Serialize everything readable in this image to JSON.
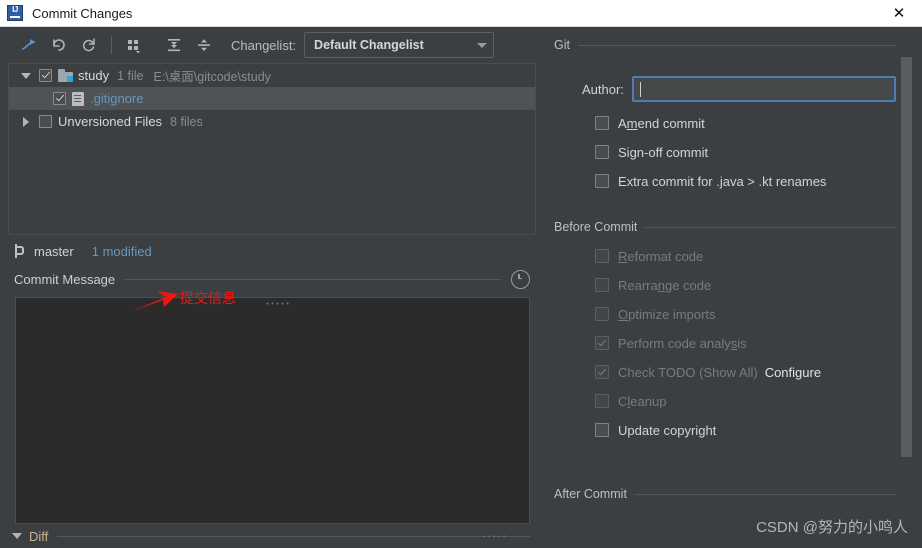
{
  "window": {
    "title": "Commit Changes",
    "app_icon": "intellij-idea-icon",
    "close_label": "✕"
  },
  "toolbar": {
    "icons": [
      {
        "name": "show-diff-icon",
        "glyph": "diff"
      },
      {
        "name": "revert-icon",
        "glyph": "revert"
      },
      {
        "name": "refresh-icon",
        "glyph": "refresh"
      },
      {
        "name": "group-by-icon",
        "glyph": "group"
      },
      {
        "name": "expand-all-icon",
        "glyph": "expand"
      },
      {
        "name": "collapse-all-icon",
        "glyph": "collapse"
      }
    ],
    "changelist_label": "Changelist:",
    "changelist_value": "Default Changelist"
  },
  "tree": {
    "rows": [
      {
        "twisty": "down",
        "checked": true,
        "icon": "folder-icon",
        "name": "study",
        "meta": "1 file",
        "path": "E:\\桌面\\gitcode\\study",
        "selected": false,
        "link": false
      },
      {
        "twisty": "none",
        "checked": true,
        "icon": "file-icon",
        "name": ".gitignore",
        "meta": "",
        "path": "",
        "selected": true,
        "link": true
      },
      {
        "twisty": "right",
        "checked": false,
        "icon": "none",
        "name": "Unversioned Files",
        "meta": "8 files",
        "path": "",
        "selected": false,
        "link": false
      }
    ]
  },
  "branch_bar": {
    "icon": "branch-icon",
    "branch": "master",
    "modified": "1 modified"
  },
  "commit_message": {
    "title": "Commit Message",
    "value": "",
    "placeholder": "",
    "history_icon": "clock-icon"
  },
  "diff": {
    "label": "Diff",
    "expanded": true
  },
  "git_section": {
    "title": "Git",
    "author_label": "Author:",
    "author_value": "",
    "author_placeholder": "",
    "options": [
      {
        "label_pre": "A",
        "label_mn": "m",
        "label_post": "end commit",
        "checked": false,
        "disabled": false,
        "name": "amend-commit-checkbox"
      },
      {
        "label_pre": "Si",
        "label_mn": "g",
        "label_post": "n-off commit",
        "checked": false,
        "disabled": false,
        "name": "sign-off-commit-checkbox"
      },
      {
        "label_pre": "Extra commit for .java > .kt renames",
        "label_mn": "",
        "label_post": "",
        "checked": false,
        "disabled": false,
        "name": "extra-commit-renames-checkbox"
      }
    ]
  },
  "before_commit_section": {
    "title": "Before Commit",
    "options": [
      {
        "label_pre": "",
        "label_mn": "R",
        "label_post": "eformat code",
        "checked": false,
        "disabled": true,
        "name": "reformat-code-checkbox"
      },
      {
        "label_pre": "Rearra",
        "label_mn": "n",
        "label_post": "ge code",
        "checked": false,
        "disabled": true,
        "name": "rearrange-code-checkbox"
      },
      {
        "label_pre": "",
        "label_mn": "O",
        "label_post": "ptimize imports",
        "checked": false,
        "disabled": true,
        "name": "optimize-imports-checkbox"
      },
      {
        "label_pre": "Perform code analy",
        "label_mn": "s",
        "label_post": "is",
        "checked": true,
        "disabled": true,
        "name": "perform-code-analysis-checkbox"
      },
      {
        "label_pre": "Check TODO (Show All)",
        "label_mn": "",
        "label_post": "",
        "checked": true,
        "disabled": true,
        "name": "check-todo-checkbox",
        "link": "Configure"
      },
      {
        "label_pre": "C",
        "label_mn": "l",
        "label_post": "eanup",
        "checked": false,
        "disabled": true,
        "name": "cleanup-checkbox"
      },
      {
        "label_pre": "Update copyright",
        "label_mn": "",
        "label_post": "",
        "checked": false,
        "disabled": false,
        "name": "update-copyright-checkbox"
      }
    ]
  },
  "after_commit_section": {
    "title": "After Commit"
  },
  "annotation": {
    "text": "提交信息",
    "arrow_color": "#f11616"
  },
  "watermark": {
    "text": "CSDN @努力的小鸣人"
  },
  "colors": {
    "window_bg": "#3c3f41",
    "titlebar_bg": "#ffffff",
    "accent_blue": "#6897bb",
    "focus_border": "#4e7cb5",
    "selection_bg": "#4f5355",
    "editor_bg": "#2b2b2b"
  }
}
